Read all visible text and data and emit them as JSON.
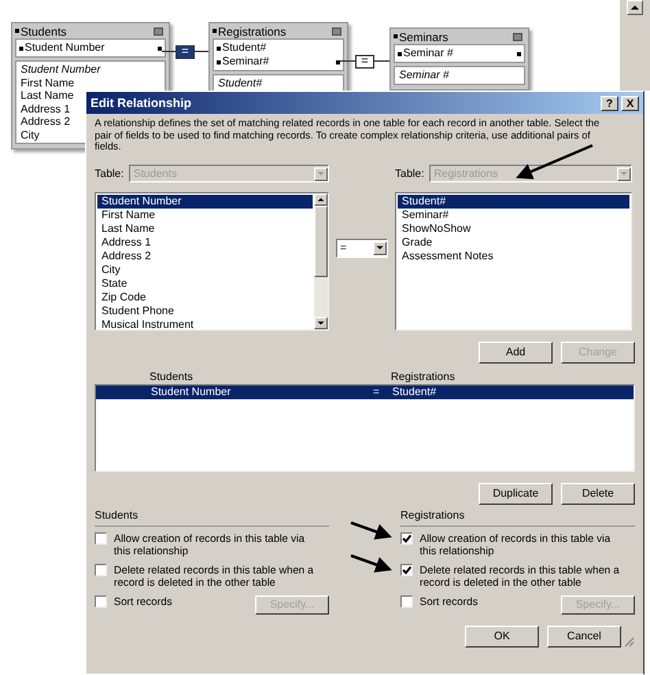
{
  "diagram": {
    "tables": [
      {
        "title": "Students",
        "match_fields": [
          "Student Number"
        ],
        "primary_field": "Student Number",
        "fields": [
          "First Name",
          "Last Name",
          "Address 1",
          "Address 2",
          "City"
        ]
      },
      {
        "title": "Registrations",
        "match_fields": [
          "Student#",
          "Seminar#"
        ],
        "primary_field": "Student#"
      },
      {
        "title": "Seminars",
        "match_fields": [
          "Seminar #"
        ],
        "primary_field": "Seminar #"
      }
    ],
    "links": [
      {
        "operator": "=",
        "selected": true
      },
      {
        "operator": "=",
        "selected": false
      }
    ]
  },
  "dialog": {
    "title": "Edit Relationship",
    "title_buttons": [
      "?",
      "X"
    ],
    "description": "A relationship defines the set of matching related records in one table for each record in another table. Select the pair of fields to be used to find matching records. To create complex relationship criteria, use additional pairs of fields.",
    "left": {
      "table_label": "Table:",
      "table": "Students",
      "fields": [
        {
          "label": "Student Number",
          "selected": true
        },
        {
          "label": "First Name",
          "selected": false
        },
        {
          "label": "Last Name",
          "selected": false
        },
        {
          "label": "Address 1",
          "selected": false
        },
        {
          "label": "Address 2",
          "selected": false
        },
        {
          "label": "City",
          "selected": false
        },
        {
          "label": "State",
          "selected": false
        },
        {
          "label": "Zip Code",
          "selected": false
        },
        {
          "label": "Student Phone",
          "selected": false
        },
        {
          "label": "Musical Instrument",
          "selected": false
        }
      ]
    },
    "operator": "=",
    "right": {
      "table_label": "Table:",
      "table": "Registrations",
      "fields": [
        {
          "label": "Student#",
          "selected": true
        },
        {
          "label": "Seminar#",
          "selected": false
        },
        {
          "label": "ShowNoShow",
          "selected": false
        },
        {
          "label": "Grade",
          "selected": false
        },
        {
          "label": "Assessment Notes",
          "selected": false
        }
      ]
    },
    "add_buttons": [
      {
        "label": "Add",
        "disabled": false
      },
      {
        "label": "Change",
        "disabled": true
      }
    ],
    "criteria": {
      "columns": [
        "Students",
        "Registrations"
      ],
      "rows": [
        {
          "left": "Student Number",
          "operator": "=",
          "right": "Student#",
          "selected": true
        }
      ]
    },
    "criteria_buttons": [
      {
        "label": "Duplicate",
        "disabled": false
      },
      {
        "label": "Delete",
        "disabled": false
      }
    ],
    "options": [
      {
        "heading": "Students",
        "checkboxes": [
          {
            "label": "Allow creation of records in this table via this relationship",
            "checked": false
          },
          {
            "label": "Delete related records in this table when a record is deleted in the other table",
            "checked": false
          },
          {
            "label": "Sort records",
            "checked": false
          }
        ],
        "specify": {
          "label": "Specify...",
          "disabled": true
        }
      },
      {
        "heading": "Registrations",
        "checkboxes": [
          {
            "label": "Allow creation of records in this table via this relationship",
            "checked": true
          },
          {
            "label": "Delete related records in this table when a record is deleted in the other table",
            "checked": true
          },
          {
            "label": "Sort records",
            "checked": false
          }
        ],
        "specify": {
          "label": "Specify...",
          "disabled": true
        }
      }
    ],
    "buttons": [
      {
        "label": "OK",
        "disabled": false
      },
      {
        "label": "Cancel",
        "disabled": false
      }
    ]
  }
}
